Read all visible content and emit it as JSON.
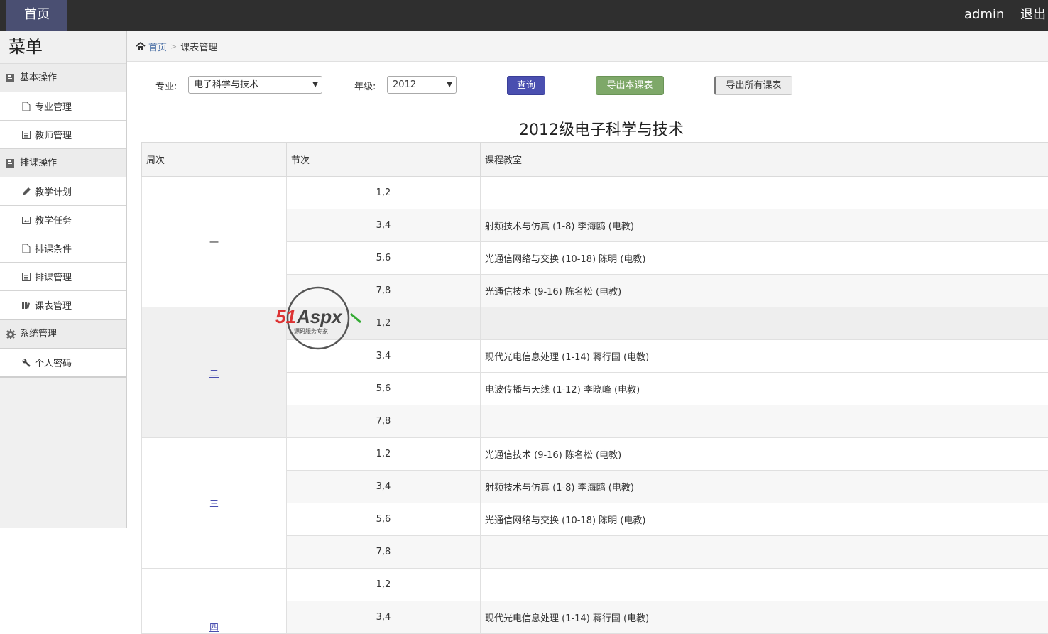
{
  "topbar": {
    "home": "首页",
    "user": "admin",
    "logout": "退出"
  },
  "sidebar": {
    "title": "菜单",
    "groups": [
      {
        "label": "基本操作",
        "icon": "book-icon",
        "items": [
          {
            "label": "专业管理",
            "icon": "file-icon"
          },
          {
            "label": "教师管理",
            "icon": "list-icon"
          }
        ]
      },
      {
        "label": "排课操作",
        "icon": "book-icon",
        "items": [
          {
            "label": "教学计划",
            "icon": "pencil-icon"
          },
          {
            "label": "教学任务",
            "icon": "picture-icon"
          },
          {
            "label": "排课条件",
            "icon": "file-icon"
          },
          {
            "label": "排课管理",
            "icon": "list-icon"
          },
          {
            "label": "课表管理",
            "icon": "books-icon"
          }
        ]
      },
      {
        "label": "系统管理",
        "icon": "gear-icon",
        "items": [
          {
            "label": "个人密码",
            "icon": "wrench-icon"
          }
        ]
      }
    ]
  },
  "breadcrumb": {
    "home": "首页",
    "current": "课表管理"
  },
  "filters": {
    "major_label": "专业:",
    "major_value": "电子科学与技术",
    "grade_label": "年级:",
    "grade_value": "2012",
    "query_button": "查询",
    "export_button": "导出本课表",
    "export_all_button": "导出所有课表"
  },
  "table": {
    "title": "2012级电子科学与技术",
    "headers": [
      "周次",
      "节次",
      "课程教室"
    ],
    "weeks": [
      {
        "label": "一",
        "rows": [
          {
            "period": "1,2",
            "course": ""
          },
          {
            "period": "3,4",
            "course": "射频技术与仿真 (1-8) 李海鸥 (电教)"
          },
          {
            "period": "5,6",
            "course": "光通信网络与交换 (10-18) 陈明 (电教)"
          },
          {
            "period": "7,8",
            "course": "光通信技术 (9-16) 陈名松 (电教)"
          }
        ]
      },
      {
        "label": "二",
        "rows": [
          {
            "period": "1,2",
            "course": ""
          },
          {
            "period": "3,4",
            "course": "现代光电信息处理 (1-14) 蒋行国 (电教)"
          },
          {
            "period": "5,6",
            "course": "电波传播与天线 (1-12) 李晓峰 (电教)"
          },
          {
            "period": "7,8",
            "course": ""
          }
        ]
      },
      {
        "label": "三",
        "rows": [
          {
            "period": "1,2",
            "course": "光通信技术 (9-16) 陈名松 (电教)"
          },
          {
            "period": "3,4",
            "course": "射频技术与仿真 (1-8) 李海鸥 (电教)"
          },
          {
            "period": "5,6",
            "course": "光通信网络与交换 (10-18) 陈明 (电教)"
          },
          {
            "period": "7,8",
            "course": ""
          }
        ]
      },
      {
        "label": "四",
        "rows": [
          {
            "period": "1,2",
            "course": ""
          },
          {
            "period": "3,4",
            "course": "现代光电信息处理 (1-14) 蒋行国 (电教)"
          }
        ]
      }
    ]
  },
  "watermark": {
    "brand": "51Aspx",
    "tagline": "源码服务专家"
  }
}
